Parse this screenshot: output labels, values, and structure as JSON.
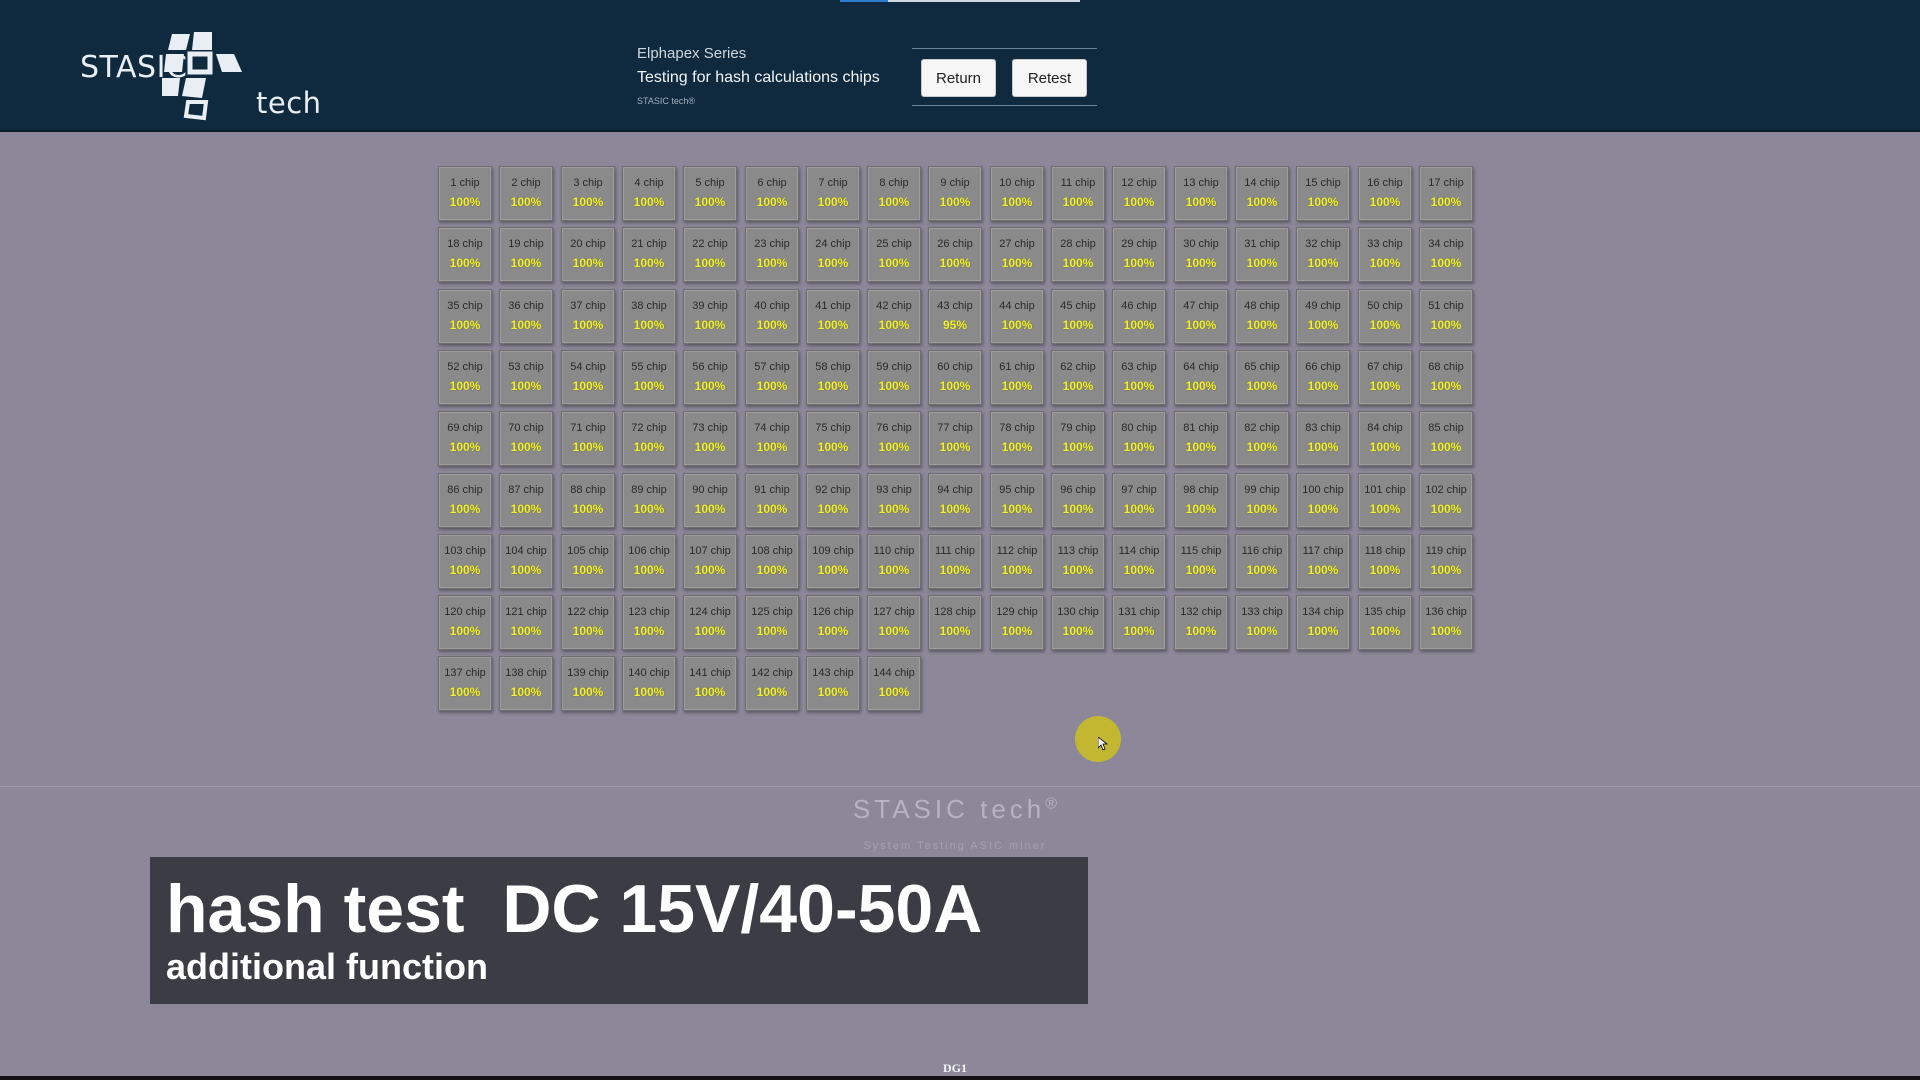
{
  "header": {
    "logo_text_left": "STASIC",
    "logo_text_right": "tech",
    "series": "Elphapex Series",
    "subtitle": "Testing for hash calculations chips",
    "brand_small": "STASIC tech®",
    "buttons": {
      "return": "Return",
      "retest": "Retest"
    },
    "colors": {
      "background": "#0f2a3f",
      "logo": "#e8eef3"
    }
  },
  "chips": {
    "per_row": 17,
    "value_color": "#f2f034",
    "items": [
      {
        "label": "1 chip",
        "value": "100%"
      },
      {
        "label": "2 chip",
        "value": "100%"
      },
      {
        "label": "3 chip",
        "value": "100%"
      },
      {
        "label": "4 chip",
        "value": "100%"
      },
      {
        "label": "5 chip",
        "value": "100%"
      },
      {
        "label": "6 chip",
        "value": "100%"
      },
      {
        "label": "7 chip",
        "value": "100%"
      },
      {
        "label": "8 chip",
        "value": "100%"
      },
      {
        "label": "9 chip",
        "value": "100%"
      },
      {
        "label": "10 chip",
        "value": "100%"
      },
      {
        "label": "11 chip",
        "value": "100%"
      },
      {
        "label": "12 chip",
        "value": "100%"
      },
      {
        "label": "13 chip",
        "value": "100%"
      },
      {
        "label": "14 chip",
        "value": "100%"
      },
      {
        "label": "15 chip",
        "value": "100%"
      },
      {
        "label": "16 chip",
        "value": "100%"
      },
      {
        "label": "17 chip",
        "value": "100%"
      },
      {
        "label": "18 chip",
        "value": "100%"
      },
      {
        "label": "19 chip",
        "value": "100%"
      },
      {
        "label": "20 chip",
        "value": "100%"
      },
      {
        "label": "21 chip",
        "value": "100%"
      },
      {
        "label": "22 chip",
        "value": "100%"
      },
      {
        "label": "23 chip",
        "value": "100%"
      },
      {
        "label": "24 chip",
        "value": "100%"
      },
      {
        "label": "25 chip",
        "value": "100%"
      },
      {
        "label": "26 chip",
        "value": "100%"
      },
      {
        "label": "27 chip",
        "value": "100%"
      },
      {
        "label": "28 chip",
        "value": "100%"
      },
      {
        "label": "29 chip",
        "value": "100%"
      },
      {
        "label": "30 chip",
        "value": "100%"
      },
      {
        "label": "31 chip",
        "value": "100%"
      },
      {
        "label": "32 chip",
        "value": "100%"
      },
      {
        "label": "33 chip",
        "value": "100%"
      },
      {
        "label": "34 chip",
        "value": "100%"
      },
      {
        "label": "35 chip",
        "value": "100%"
      },
      {
        "label": "36 chip",
        "value": "100%"
      },
      {
        "label": "37 chip",
        "value": "100%"
      },
      {
        "label": "38 chip",
        "value": "100%"
      },
      {
        "label": "39 chip",
        "value": "100%"
      },
      {
        "label": "40 chip",
        "value": "100%"
      },
      {
        "label": "41 chip",
        "value": "100%"
      },
      {
        "label": "42 chip",
        "value": "100%"
      },
      {
        "label": "43 chip",
        "value": "95%"
      },
      {
        "label": "44 chip",
        "value": "100%"
      },
      {
        "label": "45 chip",
        "value": "100%"
      },
      {
        "label": "46 chip",
        "value": "100%"
      },
      {
        "label": "47 chip",
        "value": "100%"
      },
      {
        "label": "48 chip",
        "value": "100%"
      },
      {
        "label": "49 chip",
        "value": "100%"
      },
      {
        "label": "50 chip",
        "value": "100%"
      },
      {
        "label": "51 chip",
        "value": "100%"
      },
      {
        "label": "52 chip",
        "value": "100%"
      },
      {
        "label": "53 chip",
        "value": "100%"
      },
      {
        "label": "54 chip",
        "value": "100%"
      },
      {
        "label": "55 chip",
        "value": "100%"
      },
      {
        "label": "56 chip",
        "value": "100%"
      },
      {
        "label": "57 chip",
        "value": "100%"
      },
      {
        "label": "58 chip",
        "value": "100%"
      },
      {
        "label": "59 chip",
        "value": "100%"
      },
      {
        "label": "60 chip",
        "value": "100%"
      },
      {
        "label": "61 chip",
        "value": "100%"
      },
      {
        "label": "62 chip",
        "value": "100%"
      },
      {
        "label": "63 chip",
        "value": "100%"
      },
      {
        "label": "64 chip",
        "value": "100%"
      },
      {
        "label": "65 chip",
        "value": "100%"
      },
      {
        "label": "66 chip",
        "value": "100%"
      },
      {
        "label": "67 chip",
        "value": "100%"
      },
      {
        "label": "68 chip",
        "value": "100%"
      },
      {
        "label": "69 chip",
        "value": "100%"
      },
      {
        "label": "70 chip",
        "value": "100%"
      },
      {
        "label": "71 chip",
        "value": "100%"
      },
      {
        "label": "72 chip",
        "value": "100%"
      },
      {
        "label": "73 chip",
        "value": "100%"
      },
      {
        "label": "74 chip",
        "value": "100%"
      },
      {
        "label": "75 chip",
        "value": "100%"
      },
      {
        "label": "76 chip",
        "value": "100%"
      },
      {
        "label": "77 chip",
        "value": "100%"
      },
      {
        "label": "78 chip",
        "value": "100%"
      },
      {
        "label": "79 chip",
        "value": "100%"
      },
      {
        "label": "80 chip",
        "value": "100%"
      },
      {
        "label": "81 chip",
        "value": "100%"
      },
      {
        "label": "82 chip",
        "value": "100%"
      },
      {
        "label": "83 chip",
        "value": "100%"
      },
      {
        "label": "84 chip",
        "value": "100%"
      },
      {
        "label": "85 chip",
        "value": "100%"
      },
      {
        "label": "86 chip",
        "value": "100%"
      },
      {
        "label": "87 chip",
        "value": "100%"
      },
      {
        "label": "88 chip",
        "value": "100%"
      },
      {
        "label": "89 chip",
        "value": "100%"
      },
      {
        "label": "90 chip",
        "value": "100%"
      },
      {
        "label": "91 chip",
        "value": "100%"
      },
      {
        "label": "92 chip",
        "value": "100%"
      },
      {
        "label": "93 chip",
        "value": "100%"
      },
      {
        "label": "94 chip",
        "value": "100%"
      },
      {
        "label": "95 chip",
        "value": "100%"
      },
      {
        "label": "96 chip",
        "value": "100%"
      },
      {
        "label": "97 chip",
        "value": "100%"
      },
      {
        "label": "98 chip",
        "value": "100%"
      },
      {
        "label": "99 chip",
        "value": "100%"
      },
      {
        "label": "100 chip",
        "value": "100%"
      },
      {
        "label": "101 chip",
        "value": "100%"
      },
      {
        "label": "102 chip",
        "value": "100%"
      },
      {
        "label": "103 chip",
        "value": "100%"
      },
      {
        "label": "104 chip",
        "value": "100%"
      },
      {
        "label": "105 chip",
        "value": "100%"
      },
      {
        "label": "106 chip",
        "value": "100%"
      },
      {
        "label": "107 chip",
        "value": "100%"
      },
      {
        "label": "108 chip",
        "value": "100%"
      },
      {
        "label": "109 chip",
        "value": "100%"
      },
      {
        "label": "110 chip",
        "value": "100%"
      },
      {
        "label": "111 chip",
        "value": "100%"
      },
      {
        "label": "112 chip",
        "value": "100%"
      },
      {
        "label": "113 chip",
        "value": "100%"
      },
      {
        "label": "114 chip",
        "value": "100%"
      },
      {
        "label": "115 chip",
        "value": "100%"
      },
      {
        "label": "116 chip",
        "value": "100%"
      },
      {
        "label": "117 chip",
        "value": "100%"
      },
      {
        "label": "118 chip",
        "value": "100%"
      },
      {
        "label": "119 chip",
        "value": "100%"
      },
      {
        "label": "120 chip",
        "value": "100%"
      },
      {
        "label": "121 chip",
        "value": "100%"
      },
      {
        "label": "122 chip",
        "value": "100%"
      },
      {
        "label": "123 chip",
        "value": "100%"
      },
      {
        "label": "124 chip",
        "value": "100%"
      },
      {
        "label": "125 chip",
        "value": "100%"
      },
      {
        "label": "126 chip",
        "value": "100%"
      },
      {
        "label": "127 chip",
        "value": "100%"
      },
      {
        "label": "128 chip",
        "value": "100%"
      },
      {
        "label": "129 chip",
        "value": "100%"
      },
      {
        "label": "130 chip",
        "value": "100%"
      },
      {
        "label": "131 chip",
        "value": "100%"
      },
      {
        "label": "132 chip",
        "value": "100%"
      },
      {
        "label": "133 chip",
        "value": "100%"
      },
      {
        "label": "134 chip",
        "value": "100%"
      },
      {
        "label": "135 chip",
        "value": "100%"
      },
      {
        "label": "136 chip",
        "value": "100%"
      },
      {
        "label": "137 chip",
        "value": "100%"
      },
      {
        "label": "138 chip",
        "value": "100%"
      },
      {
        "label": "139 chip",
        "value": "100%"
      },
      {
        "label": "140 chip",
        "value": "100%"
      },
      {
        "label": "141 chip",
        "value": "100%"
      },
      {
        "label": "142 chip",
        "value": "100%"
      },
      {
        "label": "143 chip",
        "value": "100%"
      },
      {
        "label": "144 chip",
        "value": "100%"
      }
    ]
  },
  "footer": {
    "brand": "STASIC tech",
    "brand_mark": "®",
    "tagline": "System Testing ASIC miner"
  },
  "caption": {
    "main": "hash test  DC 15V/40-50A",
    "sub": "additional function"
  },
  "bottom_label": "DG1"
}
